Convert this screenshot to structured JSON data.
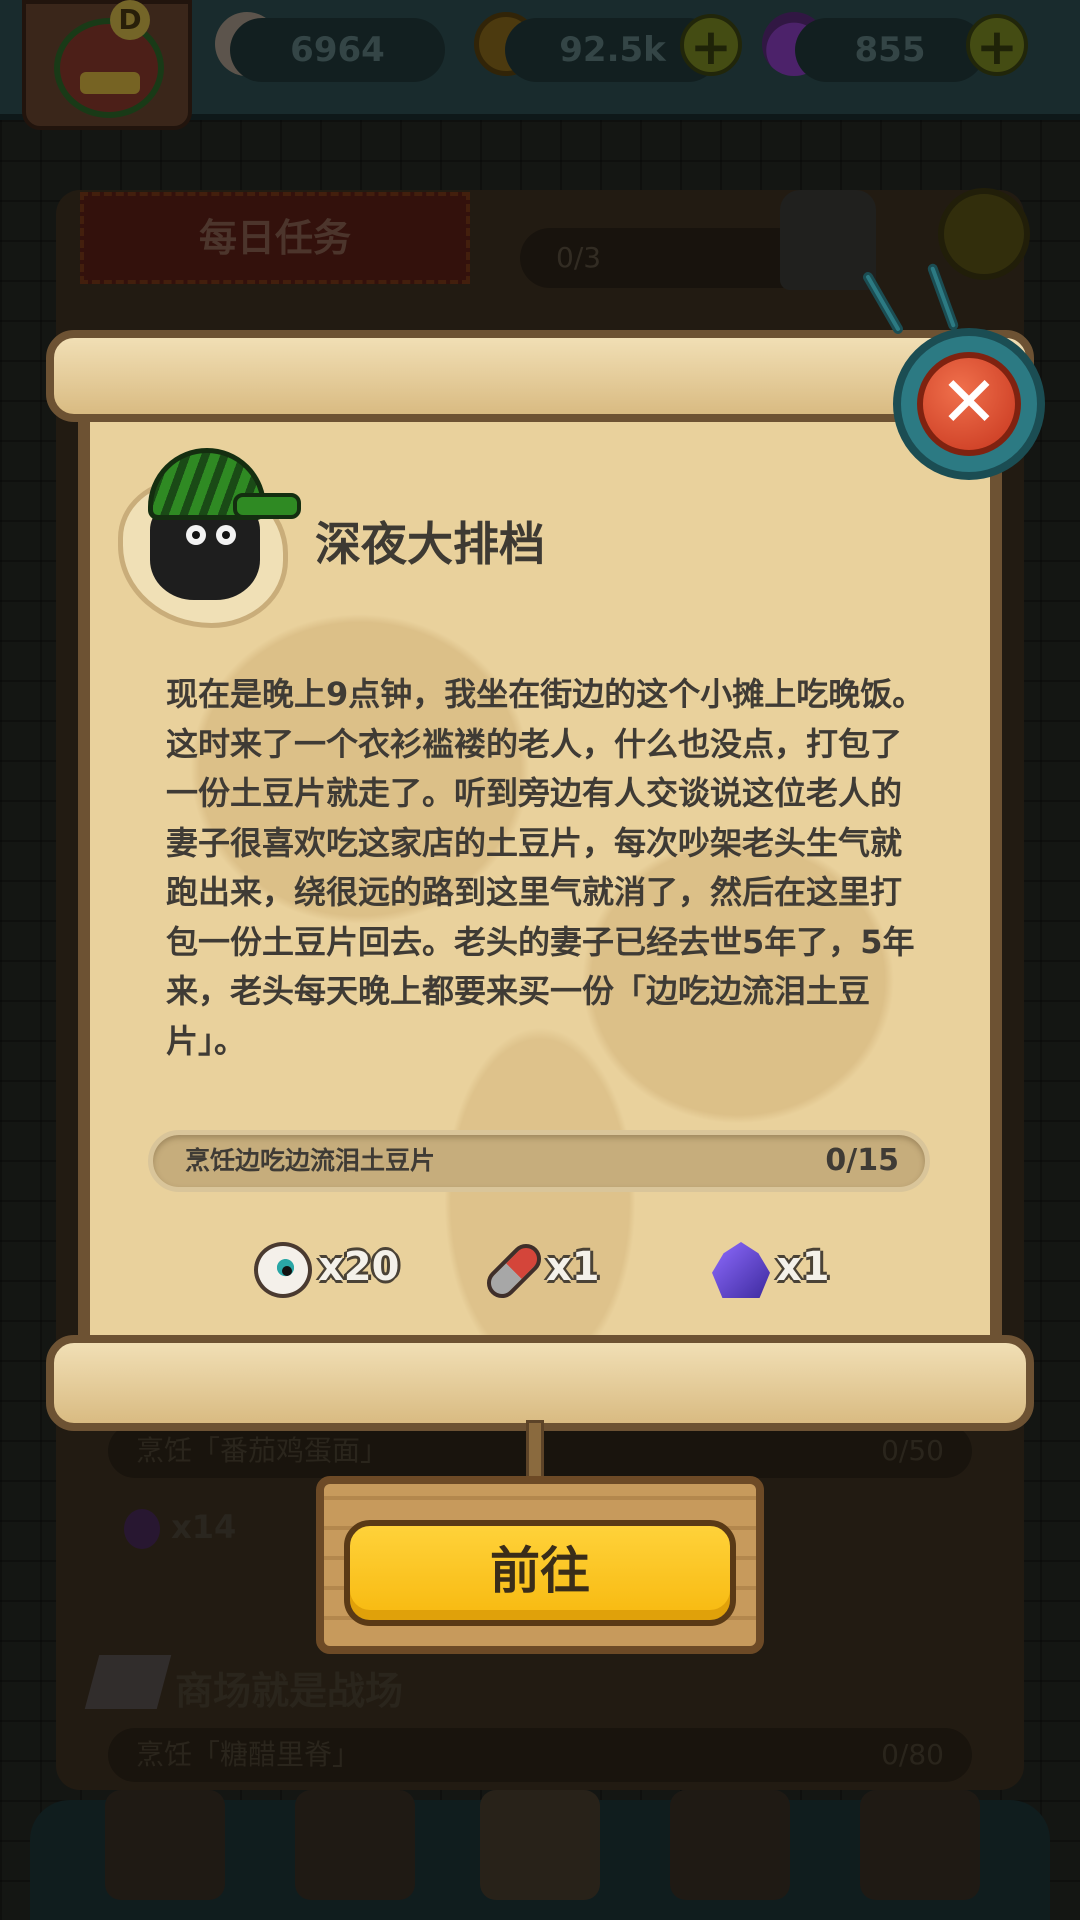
{
  "header": {
    "avatar_badge": "D",
    "eyeballs": "6964",
    "coins": "92.5k",
    "potions": "855",
    "plus_symbol": "+"
  },
  "background": {
    "tab_daily": "每日任务",
    "daily_progress": "0/3",
    "row1_label": "烹饪「番茄鸡蛋面」",
    "row1_progress": "0/50",
    "row1_reward": "x14",
    "section2_title": "商场就是战场",
    "row2_label": "烹饪「糖醋里脊」",
    "row2_progress": "0/80"
  },
  "dialog": {
    "title": "深夜大排档",
    "close_symbol": "✕",
    "story": "现在是晚上9点钟，我坐在街边的这个小摊上吃晚饭。这时来了一个衣衫褴褛的老人，什么也没点，打包了一份土豆片就走了。听到旁边有人交谈说这位老人的妻子很喜欢吃这家店的土豆片，每次吵架老头生气就跑出来，绕很远的路到这里气就消了，然后在这里打包一份土豆片回去。老头的妻子已经去世5年了，5年来，老头每天晚上都要来买一份「边吃边流泪土豆片」。",
    "task": {
      "label": "烹饪边吃边流泪土豆片",
      "progress": "0/15"
    },
    "rewards": [
      {
        "icon": "eyeball-icon",
        "count": "x20"
      },
      {
        "icon": "pill-icon",
        "count": "x1"
      },
      {
        "icon": "crystal-icon",
        "count": "x1"
      }
    ],
    "go_button": "前往"
  },
  "colors": {
    "parchment": "#e9d19c",
    "go_button": "#f7b90f",
    "close_button": "#c7361e"
  }
}
